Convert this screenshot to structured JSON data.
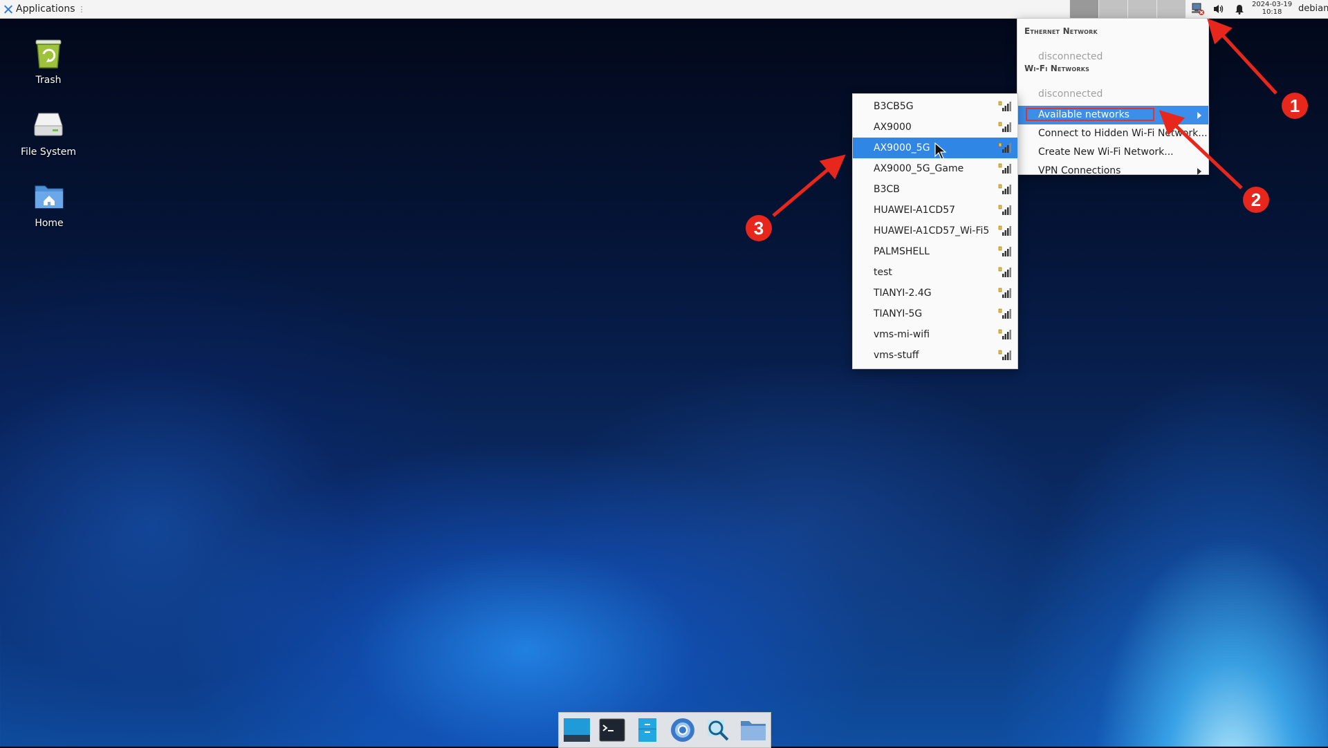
{
  "top_panel": {
    "applications_label": "Applications",
    "separator": "⋮",
    "clock_date": "2024-03-19",
    "clock_time": "10:18",
    "user": "debian"
  },
  "desktop_icons": [
    {
      "label": "Trash",
      "icon": "trash-icon"
    },
    {
      "label": "File System",
      "icon": "drive-icon"
    },
    {
      "label": "Home",
      "icon": "home-folder-icon"
    }
  ],
  "network_menu": {
    "ethernet_header": "Ethernet Network",
    "ethernet_status": "disconnected",
    "wifi_header": "Wi-Fi Networks",
    "wifi_status": "disconnected",
    "available_networks": "Available networks",
    "connect_hidden": "Connect to Hidden Wi-Fi Network...",
    "create_new": "Create New Wi-Fi Network...",
    "vpn": "VPN Connections"
  },
  "wifi_networks": [
    "B3CB5G",
    "AX9000",
    "AX9000_5G",
    "AX9000_5G_Game",
    "B3CB",
    "HUAWEI-A1CD57",
    "HUAWEI-A1CD57_Wi-Fi5",
    "PALMSHELL",
    "test",
    "TIANYI-2.4G",
    "TIANYI-5G",
    "vms-mi-wifi",
    "vms-stuff"
  ],
  "selected_network": "AX9000_5G",
  "annotations": [
    "1",
    "2",
    "3"
  ],
  "colors": {
    "highlight": "#3d8ee8",
    "annotation_red": "#e8271c",
    "panel_bg": "#f4f4f4"
  }
}
